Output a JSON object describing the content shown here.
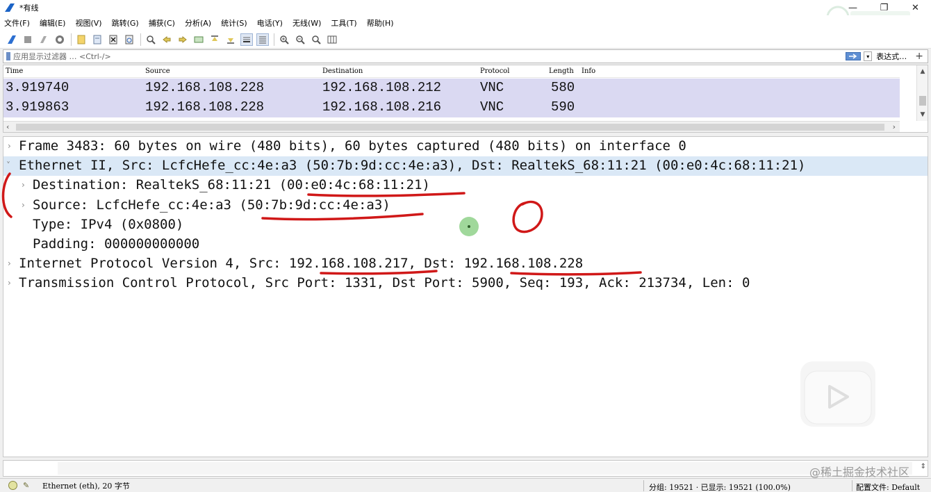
{
  "window": {
    "title": "*有线",
    "controls": [
      "minimize",
      "restore",
      "close"
    ]
  },
  "menu": [
    "文件(F)",
    "编辑(E)",
    "视图(V)",
    "跳转(G)",
    "捕获(C)",
    "分析(A)",
    "统计(S)",
    "电话(Y)",
    "无线(W)",
    "工具(T)",
    "帮助(H)"
  ],
  "filter": {
    "placeholder": "应用显示过滤器 … <Ctrl-/>",
    "expression_label": "表达式…",
    "add_label": "+"
  },
  "packet_list": {
    "columns": [
      "Time",
      "Source",
      "Destination",
      "Protocol",
      "Length",
      "Info"
    ],
    "rows": [
      {
        "time": "3.919740",
        "source": "192.168.108.228",
        "destination": "192.168.108.212",
        "protocol": "VNC",
        "length": "580",
        "info": ""
      },
      {
        "time": "3.919863",
        "source": "192.168.108.228",
        "destination": "192.168.108.216",
        "protocol": "VNC",
        "length": "590",
        "info": ""
      }
    ]
  },
  "details": {
    "rows": [
      {
        "twisty": "›",
        "text": "Frame 3483: 60 bytes on wire (480 bits), 60 bytes captured (480 bits) on interface 0",
        "selected": false
      },
      {
        "twisty": "˅",
        "text": "Ethernet II, Src: LcfcHefe_cc:4e:a3 (50:7b:9d:cc:4e:a3), Dst: RealtekS_68:11:21 (00:e0:4c:68:11:21)",
        "selected": true
      },
      {
        "twisty": "›",
        "text": "Destination: RealtekS_68:11:21 (00:e0:4c:68:11:21)",
        "selected": false
      },
      {
        "twisty": "›",
        "text": "Source: LcfcHefe_cc:4e:a3 (50:7b:9d:cc:4e:a3)",
        "selected": false
      },
      {
        "twisty": "",
        "text": "Type: IPv4 (0x0800)",
        "selected": false
      },
      {
        "twisty": "",
        "text": "Padding: 000000000000",
        "selected": false
      },
      {
        "twisty": "›",
        "text": "Internet Protocol Version 4, Src: 192.168.108.217, Dst: 192.168.108.228",
        "selected": false
      },
      {
        "twisty": "›",
        "text": "Transmission Control Protocol, Src Port: 1331, Dst Port: 5900, Seq: 193, Ack: 213734, Len: 0",
        "selected": false
      }
    ]
  },
  "annotation": {
    "mark": "0",
    "color": "#d01818"
  },
  "watermark": "@稀土掘金技术社区",
  "statusbar": {
    "left": "Ethernet (eth), 20 字节",
    "packets": "分组: 19521 · 已显示: 19521 (100.0%)",
    "profile": "配置文件: Default"
  },
  "colors": {
    "packet_row_bg": "#dad9f2",
    "selected_detail_bg": "#dae8f6",
    "annotation_red": "#d01818"
  }
}
